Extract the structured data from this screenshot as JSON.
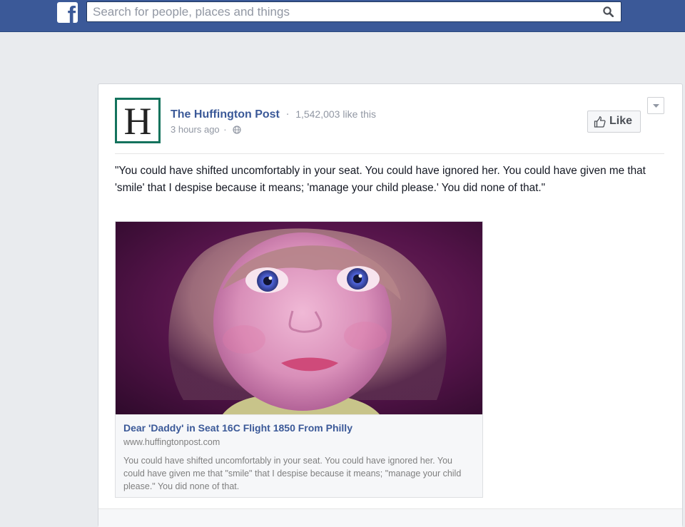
{
  "topbar": {
    "logo_letter": "f",
    "search_placeholder": "Search for people, places and things",
    "search_icon": "magnifier-icon",
    "brand_color": "#3b5998"
  },
  "story": {
    "page_avatar_letter": "H",
    "page_name": "The Huffington Post",
    "separator": "·",
    "like_count": "1,542,003 like this",
    "time": "3 hours ago",
    "audience_icon": "globe-icon",
    "like_button_label": "Like",
    "like_icon": "thumbs-up-icon",
    "options_icon": "chevron-down-icon",
    "message": "\"You could have shifted uncomfortably in your seat. You could have ignored her. You could have given me that 'smile' that I despise because it means; 'manage your child please.' You did none of that.\"",
    "attachment": {
      "title": "Dear 'Daddy' in Seat 16C Flight 1850 From Philly",
      "domain": "www.huffingtonpost.com",
      "description": "You could have shifted uncomfortably in your seat. You could have ignored her. You could have given me that \"smile\" that I despise because it means; \"manage your child please.\" You did none of that."
    }
  }
}
